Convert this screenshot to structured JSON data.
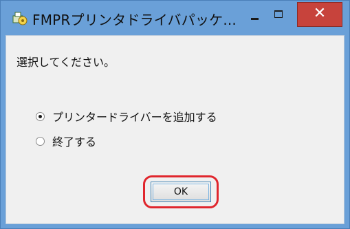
{
  "window": {
    "title": "FMPRプリンタドライバパッケ...",
    "icon": "printer-package-icon",
    "controls": {
      "minimize": "minimize-icon",
      "maximize": "maximize-icon",
      "close_label": "✕"
    }
  },
  "dialog": {
    "prompt": "選択してください。",
    "options": [
      {
        "label": "プリンタードライバーを追加する",
        "selected": true
      },
      {
        "label": "終了する",
        "selected": false
      }
    ],
    "ok_label": "OK"
  },
  "colors": {
    "title_bar": "#6aa0d8",
    "close_button": "#c7433c",
    "client_background": "#f0f0f0",
    "highlight": "#e0262d"
  }
}
